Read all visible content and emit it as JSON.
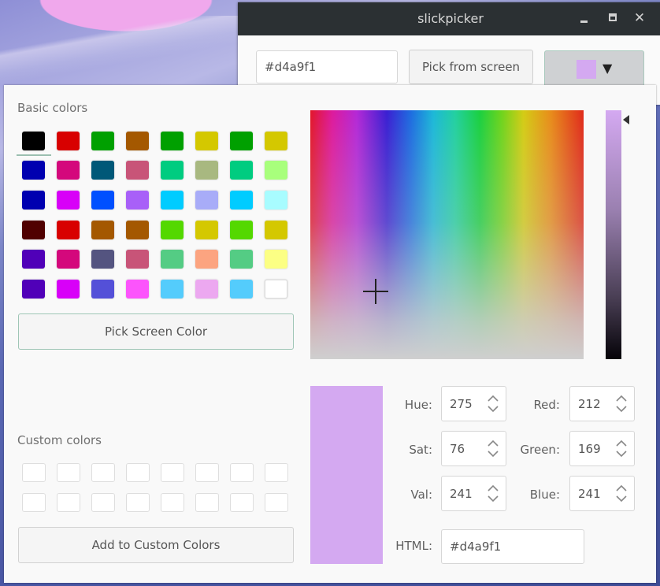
{
  "window": {
    "title": "slickpicker",
    "controls": [
      "minimize",
      "maximize",
      "close"
    ],
    "close_glyph": "✕",
    "hex_value": "#d4a9f1",
    "pick_from_screen_label": "Pick from screen",
    "current_color": "#d4a9f1",
    "dropdown_arrow": "▼"
  },
  "dialog": {
    "basic_colors_label": "Basic colors",
    "basic_colors": [
      [
        "#000000",
        "#d80000",
        "#00a000",
        "#a45800",
        "#00a000",
        "#d4c800",
        "#00a000",
        "#d4c800"
      ],
      [
        "#0000b0",
        "#d4087c",
        "#005878",
        "#c85478",
        "#00cc80",
        "#a8b880",
        "#00cc80",
        "#a8ff7c"
      ],
      [
        "#0000b0",
        "#d800f8",
        "#0050ff",
        "#a860f8",
        "#00ccff",
        "#a8acf8",
        "#00ccff",
        "#a8fcff"
      ],
      [
        "#500000",
        "#d80000",
        "#a45800",
        "#a45800",
        "#54d800",
        "#d4c800",
        "#54d800",
        "#d4c800"
      ],
      [
        "#5000b8",
        "#d4087c",
        "#545480",
        "#c85478",
        "#54cc84",
        "#fca480",
        "#54cc84",
        "#fcff84"
      ],
      [
        "#5000b8",
        "#d800f8",
        "#5450d8",
        "#fc54fc",
        "#54ccfc",
        "#eca8f0",
        "#54ccfc",
        "#ffffff"
      ]
    ],
    "selected_basic_color_index": 0,
    "pick_screen_color_label": "Pick Screen Color",
    "custom_colors_label": "Custom colors",
    "custom_colors_count": 16,
    "add_custom_label": "Add to Custom Colors",
    "value_slider_level": 1.0,
    "selected_color": "#d4a9f1",
    "fields": {
      "hue": {
        "label": "Hue:",
        "value": "275"
      },
      "sat": {
        "label": "Sat:",
        "value": "76"
      },
      "val": {
        "label": "Val:",
        "value": "241"
      },
      "red": {
        "label": "Red:",
        "value": "212"
      },
      "green": {
        "label": "Green:",
        "value": "169"
      },
      "blue": {
        "label": "Blue:",
        "value": "241"
      },
      "html": {
        "label": "HTML:",
        "value": "#d4a9f1"
      }
    }
  }
}
